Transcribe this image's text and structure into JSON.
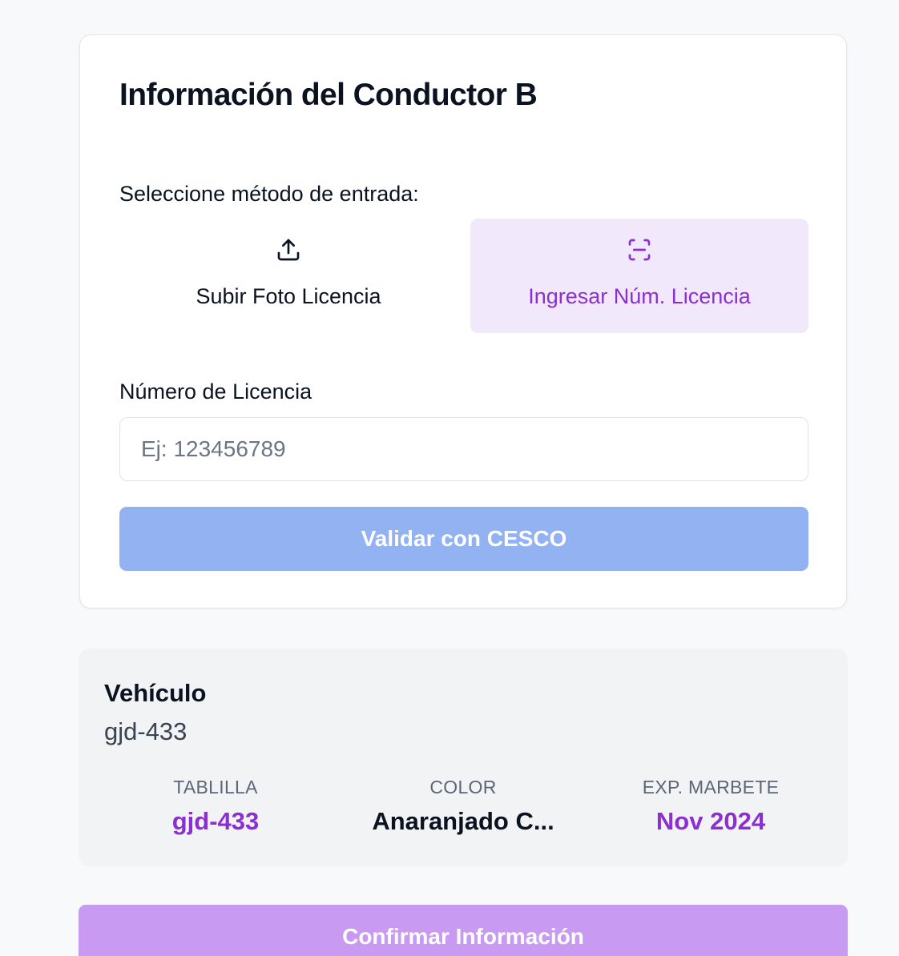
{
  "card": {
    "title": "Información del Conductor B",
    "method_label": "Seleccione método de entrada:",
    "methods": [
      {
        "label": "Subir Foto Licencia",
        "icon": "upload-icon",
        "selected": false
      },
      {
        "label": "Ingresar Núm. Licencia",
        "icon": "scan-icon",
        "selected": true
      }
    ],
    "license_field": {
      "label": "Número de Licencia",
      "placeholder": "Ej: 123456789",
      "value": ""
    },
    "validate_label": "Validar con CESCO"
  },
  "vehicle": {
    "title": "Vehículo",
    "plate": "gjd-433",
    "stats": [
      {
        "label": "TABLILLA",
        "value": "gjd-433"
      },
      {
        "label": "COLOR",
        "value": "Anaranjado C..."
      },
      {
        "label": "EXP. MARBETE",
        "value": "Nov 2024"
      }
    ]
  },
  "confirm_label": "Confirmar Información",
  "colors": {
    "accent": "#8b2fd1",
    "accent_soft_bg": "#f1e8fc",
    "validate_button": "#93b2f2",
    "confirm_button": "#c89af1"
  }
}
